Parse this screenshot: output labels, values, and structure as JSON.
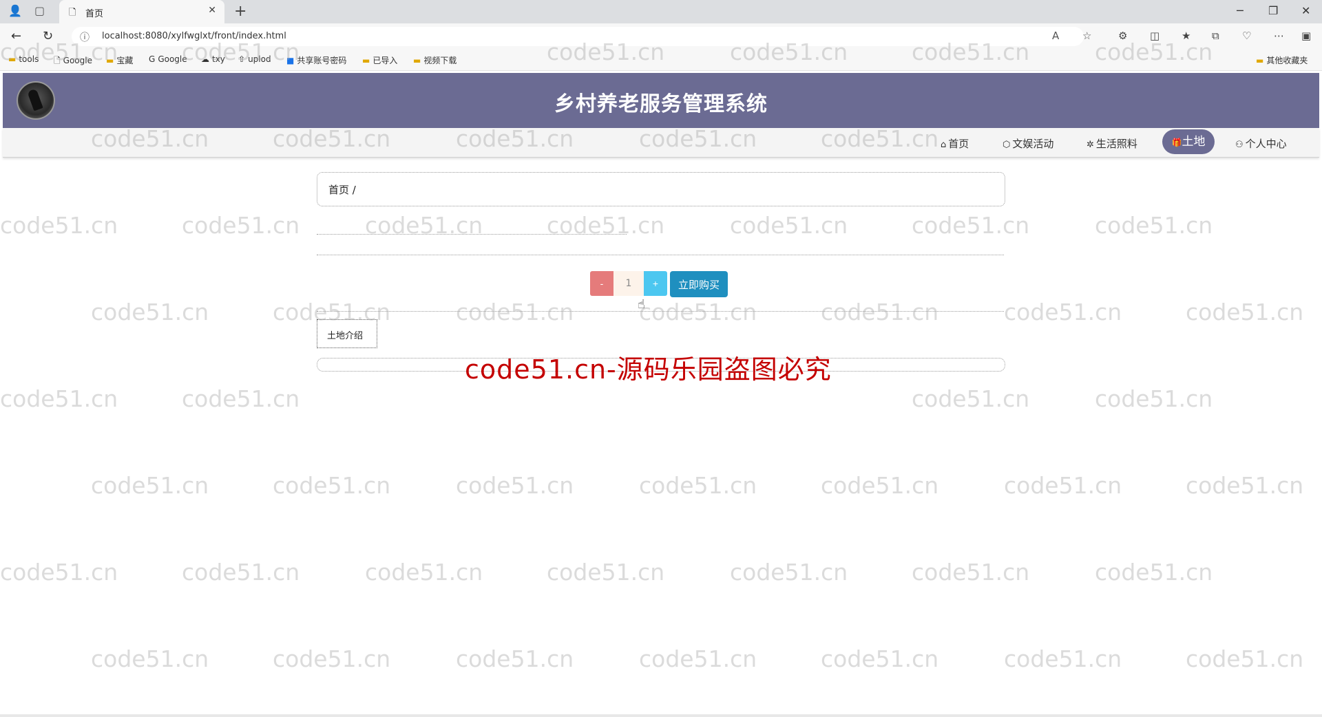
{
  "browser": {
    "tab_title": "首页",
    "tab_icon": "page-icon",
    "new_tab": "+",
    "url": "localhost:8080/xylfwglxt/front/index.html",
    "bookmarks": [
      {
        "label": "tools",
        "icon": "folder-icon"
      },
      {
        "label": "Google",
        "icon": "page-icon"
      },
      {
        "label": "宝藏",
        "icon": "folder-icon"
      },
      {
        "label": "Google",
        "icon": "google-icon"
      },
      {
        "label": "txy",
        "icon": "cloud-icon"
      },
      {
        "label": "uplod",
        "icon": "upload-icon"
      },
      {
        "label": "共享账号密码",
        "icon": "app-icon"
      },
      {
        "label": "已导入",
        "icon": "folder-icon"
      },
      {
        "label": "视频下载",
        "icon": "folder-icon"
      }
    ],
    "other_bookmarks": "其他收藏夹"
  },
  "site": {
    "title": "乡村养老服务管理系统",
    "nav": [
      {
        "label": "首页",
        "icon": "home-icon"
      },
      {
        "label": "文娱活动",
        "icon": "box-icon"
      },
      {
        "label": "生活照料",
        "icon": "gear-icon"
      },
      {
        "label": "土地",
        "icon": "gift-icon",
        "active": true
      },
      {
        "label": "个人中心",
        "icon": "user-icon"
      }
    ]
  },
  "content": {
    "breadcrumb": "首页 /",
    "quantity": "1",
    "minus_label": "-",
    "plus_label": "+",
    "buy_label": "立即购买",
    "intro_tab": "土地介绍"
  },
  "watermark": {
    "text": "code51.cn",
    "banner": "code51.cn-源码乐园盗图必究"
  },
  "colors": {
    "header_bg": "#6b6b93",
    "active_nav": "#6b6b93",
    "buy_button": "#1f8fbf",
    "minus_button": "#e57b7b",
    "plus_button": "#4cc7f0",
    "banner_text": "#c40000"
  }
}
